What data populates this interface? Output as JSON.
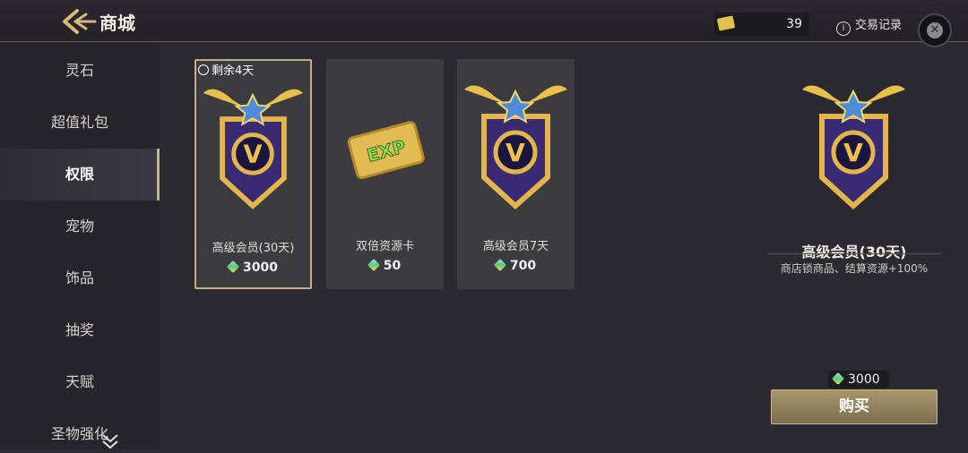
{
  "header": {
    "title": "商城",
    "ticket_count": "39",
    "history_label": "交易记录",
    "history_icon": "info-icon",
    "close_icon": "close-icon"
  },
  "sidebar": {
    "items": [
      {
        "label": "灵石",
        "active": false
      },
      {
        "label": "超值礼包",
        "active": false
      },
      {
        "label": "权限",
        "active": true
      },
      {
        "label": "宠物",
        "active": false
      },
      {
        "label": "饰品",
        "active": false
      },
      {
        "label": "抽奖",
        "active": false
      },
      {
        "label": "天赋",
        "active": false
      },
      {
        "label": "圣物强化",
        "active": false
      }
    ],
    "scroll_icon": "chevron-double-down-icon"
  },
  "products": [
    {
      "timer": "剩余4天",
      "name": "高级会员(30天)",
      "price": "3000",
      "icon": "vip-badge-icon",
      "selected": true
    },
    {
      "name": "双倍资源卡",
      "price": "50",
      "icon": "exp-card-icon",
      "selected": false
    },
    {
      "name": "高级会员7天",
      "price": "700",
      "icon": "vip-badge-icon",
      "selected": false
    }
  ],
  "detail": {
    "name": "高级会员(30天)",
    "description": "商店锁商品、结算资源+100%",
    "cost": "3000",
    "buy_label": "购买"
  },
  "colors": {
    "background": "#2a2a30",
    "sidebar": "#26252b",
    "card": "#3b3b40",
    "accent_gold": "#c4b182",
    "buy_button": "#a8966d"
  }
}
